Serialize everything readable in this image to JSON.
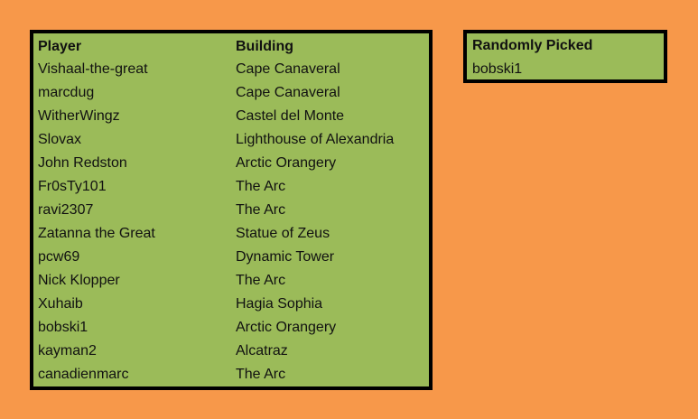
{
  "players_table": {
    "headers": {
      "player": "Player",
      "building": "Building"
    },
    "rows": [
      {
        "player": "Vishaal-the-great",
        "building": "Cape Canaveral"
      },
      {
        "player": "marcdug",
        "building": "Cape Canaveral"
      },
      {
        "player": "WitherWingz",
        "building": "Castel del Monte"
      },
      {
        "player": "Slovax",
        "building": "Lighthouse of Alexandria"
      },
      {
        "player": "John Redston",
        "building": "Arctic Orangery"
      },
      {
        "player": "Fr0sTy101",
        "building": "The Arc"
      },
      {
        "player": "ravi2307",
        "building": "The Arc"
      },
      {
        "player": "Zatanna the Great",
        "building": "Statue of Zeus"
      },
      {
        "player": "pcw69",
        "building": "Dynamic Tower"
      },
      {
        "player": "Nick Klopper",
        "building": "The Arc"
      },
      {
        "player": "Xuhaib",
        "building": "Hagia Sophia"
      },
      {
        "player": "bobski1",
        "building": "Arctic Orangery"
      },
      {
        "player": "kayman2",
        "building": "Alcatraz"
      },
      {
        "player": "canadienmarc",
        "building": "The Arc"
      }
    ]
  },
  "random_pick": {
    "title": "Randomly Picked",
    "value": "bobski1"
  },
  "colors": {
    "background": "#F7984A",
    "panel": "#9BBB59",
    "border": "#000000"
  }
}
